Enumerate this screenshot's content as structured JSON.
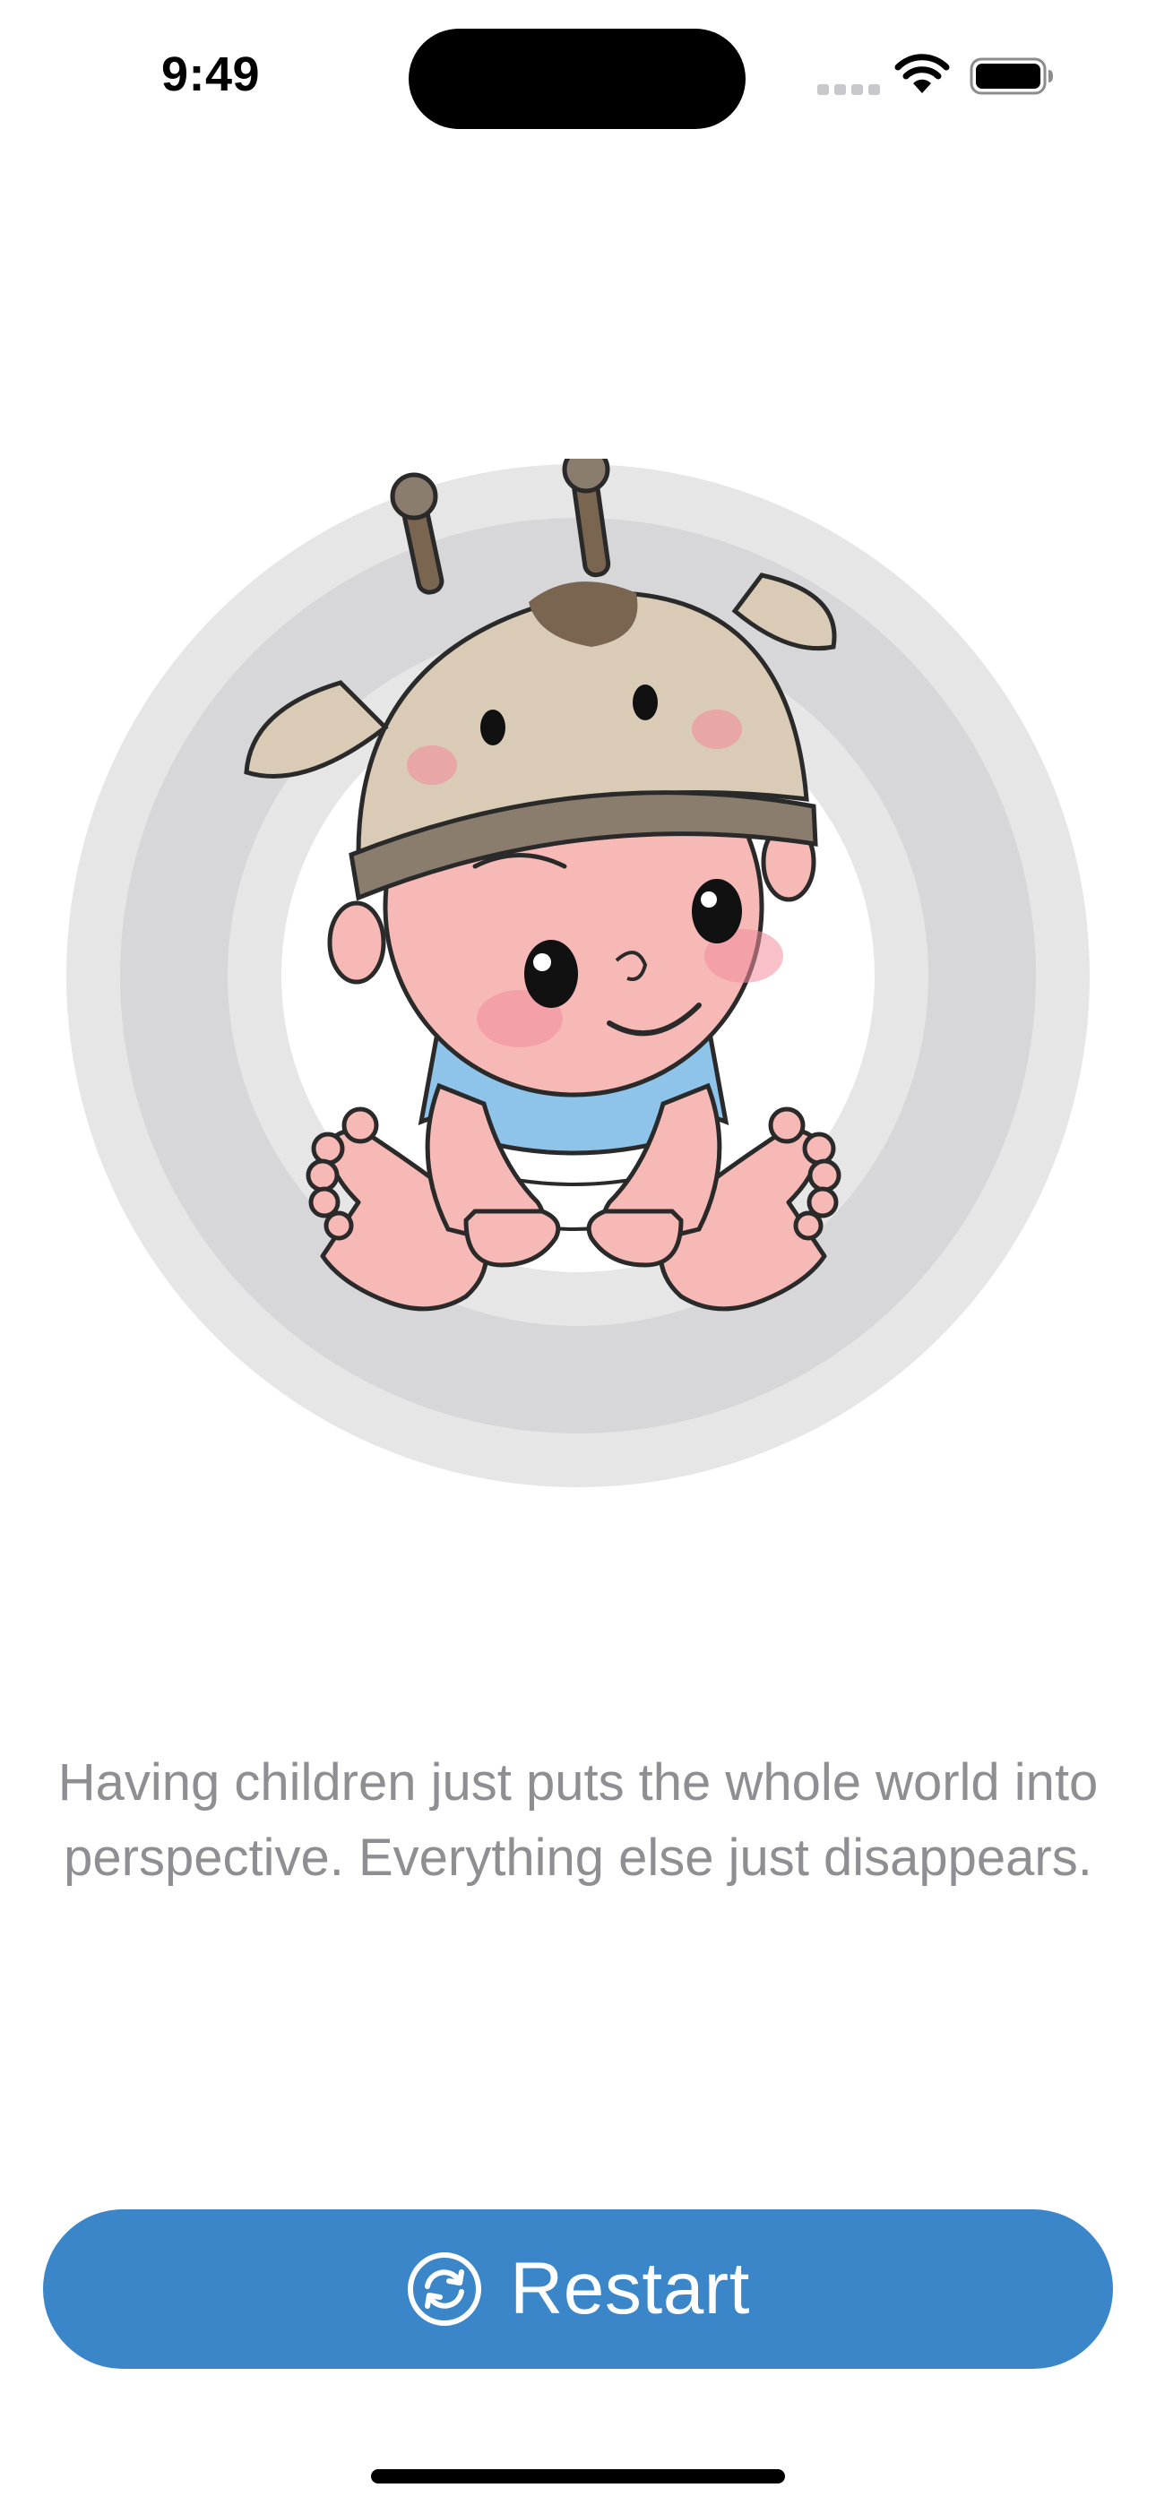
{
  "status_bar": {
    "time": "9:49",
    "icons": [
      "cellular-signal-icon",
      "wifi-icon",
      "battery-icon"
    ]
  },
  "illustration": {
    "name": "baby-giraffe-hat-illustration",
    "ring_colors": [
      "#e6e6e7",
      "#d7d7d9"
    ]
  },
  "quote": {
    "text": "Having children just puts the whole world into perspective. Everything else just disappears."
  },
  "restart_button": {
    "label": "Restart",
    "icon": "refresh-icon",
    "color": "#3a86c8"
  }
}
